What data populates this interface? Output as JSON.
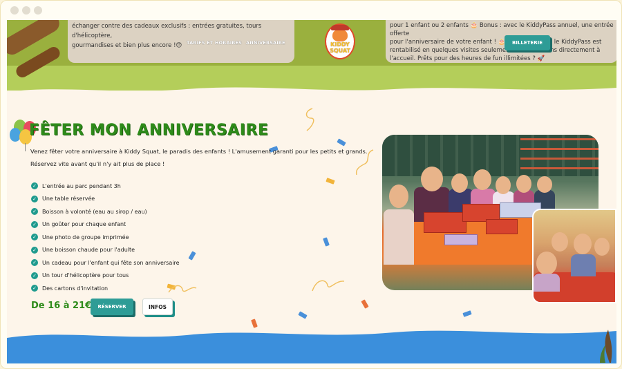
{
  "header": {
    "left_info_text_line1": "échanger contre des cadeaux exclusifs : entrées gratuites, tours d'hélicoptère,",
    "left_info_text_line2": "gourmandises et bien plus encore !😍",
    "right_info_text_line1": "pour 1 enfant ou 2 enfants 🎂 Bonus : avec le KiddyPass annuel, une entrée offerte",
    "right_info_text_line2": "pour l'anniversaire de votre enfant ! 🎂 Un r",
    "right_info_text_line2b": "le KiddyPass est",
    "right_info_text_line3": "rentabilisé en quelques visites seulement !",
    "right_info_text_line3b": "ons directement à",
    "right_info_text_line4": "l'accueil. Prêts pour des heures de fun illimitées ? 🚀",
    "nav_tarifs": "TARIFS ET HORAIRES",
    "nav_anniversaire": "ANNIVERSAIRE",
    "logo_line1": "KIDDY",
    "logo_line2": "SQUAT",
    "billetterie_label": "BILLETERIE"
  },
  "main": {
    "title": "FÊTER MON ANNIVERSAIRE",
    "intro_line1": "Venez fêter votre anniversaire à Kiddy Squat, le paradis des enfants ! L'amusement garanti pour les petits et grands.",
    "intro_line2": "Réservez vite avant qu'il n'y ait plus de place !",
    "items": [
      "L'entrée au parc pendant 3h",
      "Une table réservée",
      "Boisson à volonté (eau au sirop / eau)",
      "Un goûter pour chaque enfant",
      "Une photo de groupe imprimée",
      "Une boisson chaude pour l'adulte",
      "Un cadeau pour l'enfant qui fête son anniversaire",
      "Un tour d'hélicoptère pour tous",
      "Des cartons d'invitation"
    ],
    "price": "De 16 à 21€",
    "reserve_label": "RÉSERVER",
    "infos_label": "INFOS"
  },
  "colors": {
    "accent_green": "#2e8b1a",
    "teal_button": "#2e9c96",
    "header_green": "#9ab03e",
    "wave_blue": "#3b8fdc"
  },
  "icons": {
    "check": "check-circle-icon",
    "balloons": "balloons-icon"
  }
}
